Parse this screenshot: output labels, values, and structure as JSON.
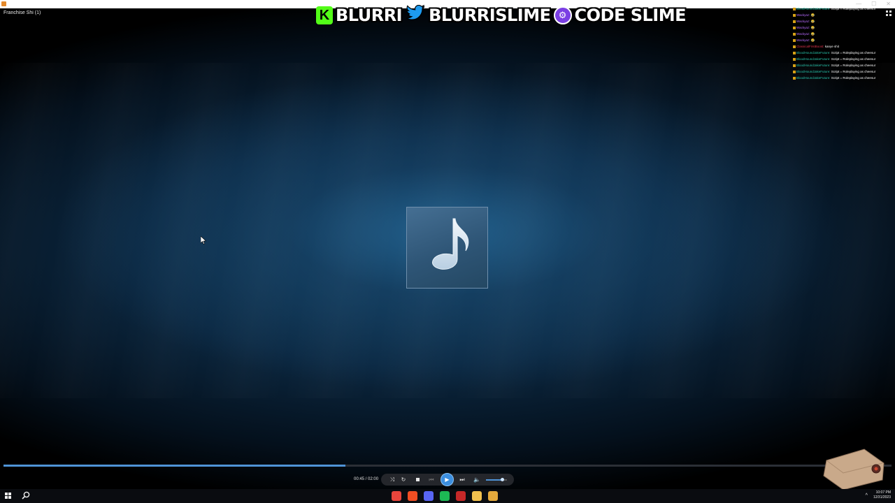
{
  "window": {
    "track_title": "Franchise Shi (1)",
    "controls": [
      "—",
      "☐",
      "✕"
    ]
  },
  "banner": {
    "kick_logo": "K",
    "kick_name": "BLURRI",
    "twitter_name": "BLURRISLIME",
    "code_text": "CODE SLIME"
  },
  "chat": {
    "lines": [
      {
        "user": "BloodHoundJakeFuture",
        "user_color": "#27c1a9",
        "msg": "Script = Roleplaying as cheesur"
      },
      {
        "user": "Wackyaz",
        "user_color": "#b86bff",
        "msg": "😂"
      },
      {
        "user": "Wackyaz",
        "user_color": "#b86bff",
        "msg": "😂"
      },
      {
        "user": "Wackyaz",
        "user_color": "#b86bff",
        "msg": "😂"
      },
      {
        "user": "Wackyaz",
        "user_color": "#b86bff",
        "msg": "😂"
      },
      {
        "user": "Wackyaz",
        "user_color": "#b86bff",
        "msg": "😂"
      },
      {
        "user": "ClassicalFirstBoost",
        "user_color": "#e0334c",
        "msg": "kanye shit"
      },
      {
        "user": "BloodHoundJakeFuture",
        "user_color": "#27c1a9",
        "msg": "Script = Roleplaying as cheesur"
      },
      {
        "user": "BloodHoundJakeFuture",
        "user_color": "#27c1a9",
        "msg": "Script = Roleplaying as cheesur"
      },
      {
        "user": "BloodHoundJakeFuture",
        "user_color": "#27c1a9",
        "msg": "Script = Roleplaying as cheesur"
      },
      {
        "user": "BloodHoundJakeFuture",
        "user_color": "#27c1a9",
        "msg": "Script = Roleplaying as cheesur"
      },
      {
        "user": "BloodHoundJakeFuture",
        "user_color": "#27c1a9",
        "msg": "Script = Roleplaying as cheesur"
      }
    ]
  },
  "player": {
    "current_time": "00:45",
    "duration": "02:00",
    "time_display": "00:45 / 02:00",
    "progress_fraction": 0.385,
    "volume_fraction": 0.75,
    "buttons": {
      "shuffle": "shuffle-icon",
      "repeat": "repeat-icon",
      "stop": "stop-icon",
      "previous": "previous-icon",
      "play": "play-icon",
      "next": "next-icon",
      "volume": "volume-icon"
    },
    "accent_color": "#3c8fe0"
  },
  "taskbar": {
    "apps": [
      {
        "name": "chrome-icon",
        "color": "#e8453c"
      },
      {
        "name": "brave-icon",
        "color": "#f04e23"
      },
      {
        "name": "chat-app-icon",
        "color": "#5865f2"
      },
      {
        "name": "spotify-icon",
        "color": "#1db954"
      },
      {
        "name": "record-app-icon",
        "color": "#c62828"
      },
      {
        "name": "file-explorer-icon",
        "color": "#f2c14e"
      },
      {
        "name": "media-player-icon",
        "color": "#e3a93c"
      }
    ],
    "time": "10:07 PM",
    "date": "12/31/2023"
  }
}
